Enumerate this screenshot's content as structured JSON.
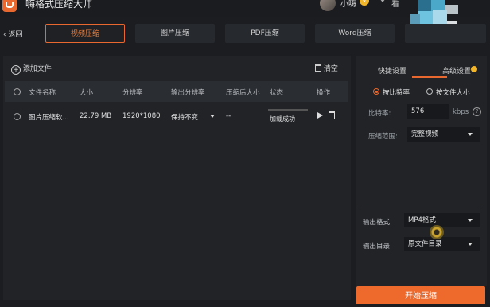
{
  "app": {
    "title": "嗨格式压缩大师",
    "username": "小嗨",
    "msg_label": "看",
    "vip_badge": "V"
  },
  "nav": {
    "back_label": "返回",
    "tabs": [
      {
        "label": "视频压缩",
        "active": true
      },
      {
        "label": "图片压缩",
        "active": false
      },
      {
        "label": "PDF压缩",
        "active": false
      },
      {
        "label": "Word压缩",
        "active": false
      }
    ]
  },
  "toolbar": {
    "add_label": "添加文件",
    "clear_label": "清空"
  },
  "table": {
    "headers": [
      "文件名称",
      "大小",
      "分辨率",
      "输出分辨率",
      "压缩后大小",
      "状态",
      "操作"
    ],
    "rows": [
      {
        "name": "图片压缩软...",
        "size": "22.79 MB",
        "resolution": "1920*1080",
        "output_resolution": "保持不变",
        "compressed_size": "--",
        "status": "加载成功"
      }
    ]
  },
  "settings": {
    "tabs": [
      {
        "label": "快捷设置",
        "active": false
      },
      {
        "label": "高级设置",
        "active": true
      }
    ],
    "mode_options": [
      {
        "label": "按比特率",
        "selected": true
      },
      {
        "label": "按文件大小",
        "selected": false
      }
    ],
    "bitrate_label": "比特率:",
    "bitrate_value": "576",
    "bitrate_unit": "kbps",
    "range_label": "压缩范围:",
    "range_value": "完整视频",
    "format_label": "输出格式:",
    "format_value": "MP4格式",
    "dir_label": "输出目录:",
    "dir_value": "原文件目录",
    "start_label": "开始压缩"
  },
  "colors": {
    "accent": "#ee6a2c",
    "background": "#1b1d21",
    "panel": "#212327"
  }
}
